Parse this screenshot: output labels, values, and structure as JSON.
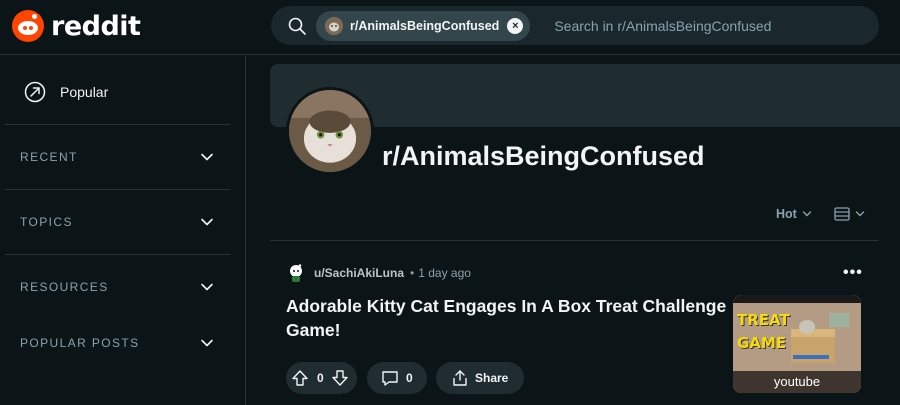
{
  "header": {
    "logo_text": "reddit",
    "search": {
      "chip_label": "r/AnimalsBeingConfused",
      "placeholder": "Search in r/AnimalsBeingConfused"
    }
  },
  "sidebar": {
    "popular_label": "Popular",
    "sections": [
      "RECENT",
      "TOPICS",
      "RESOURCES",
      "POPULAR POSTS"
    ]
  },
  "subreddit": {
    "name": "r/AnimalsBeingConfused",
    "sort_label": "Hot"
  },
  "post": {
    "author": "u/SachiAkiLuna",
    "separator": "•",
    "time": "1 day ago",
    "title": "Adorable Kitty Cat Engages In A Box Treat Challenge Game!",
    "vote_count": "0",
    "comment_count": "0",
    "share_label": "Share",
    "thumbnail_caption": "youtube",
    "thumbnail_text_1": "TREAT",
    "thumbnail_text_2": "GAME"
  },
  "colors": {
    "background": "#0b1416",
    "brand": "#ff4500",
    "surface": "#1f2c30",
    "muted_text": "#8ba2ad"
  },
  "icons": {
    "search": "search-icon",
    "close": "close-icon",
    "popular": "trending-arrow-icon",
    "chevron": "chevron-down-icon",
    "upvote": "upvote-arrow-icon",
    "downvote": "downvote-arrow-icon",
    "comment": "comment-bubble-icon",
    "share": "share-icon",
    "more": "more-dots-icon",
    "view": "card-view-icon"
  }
}
